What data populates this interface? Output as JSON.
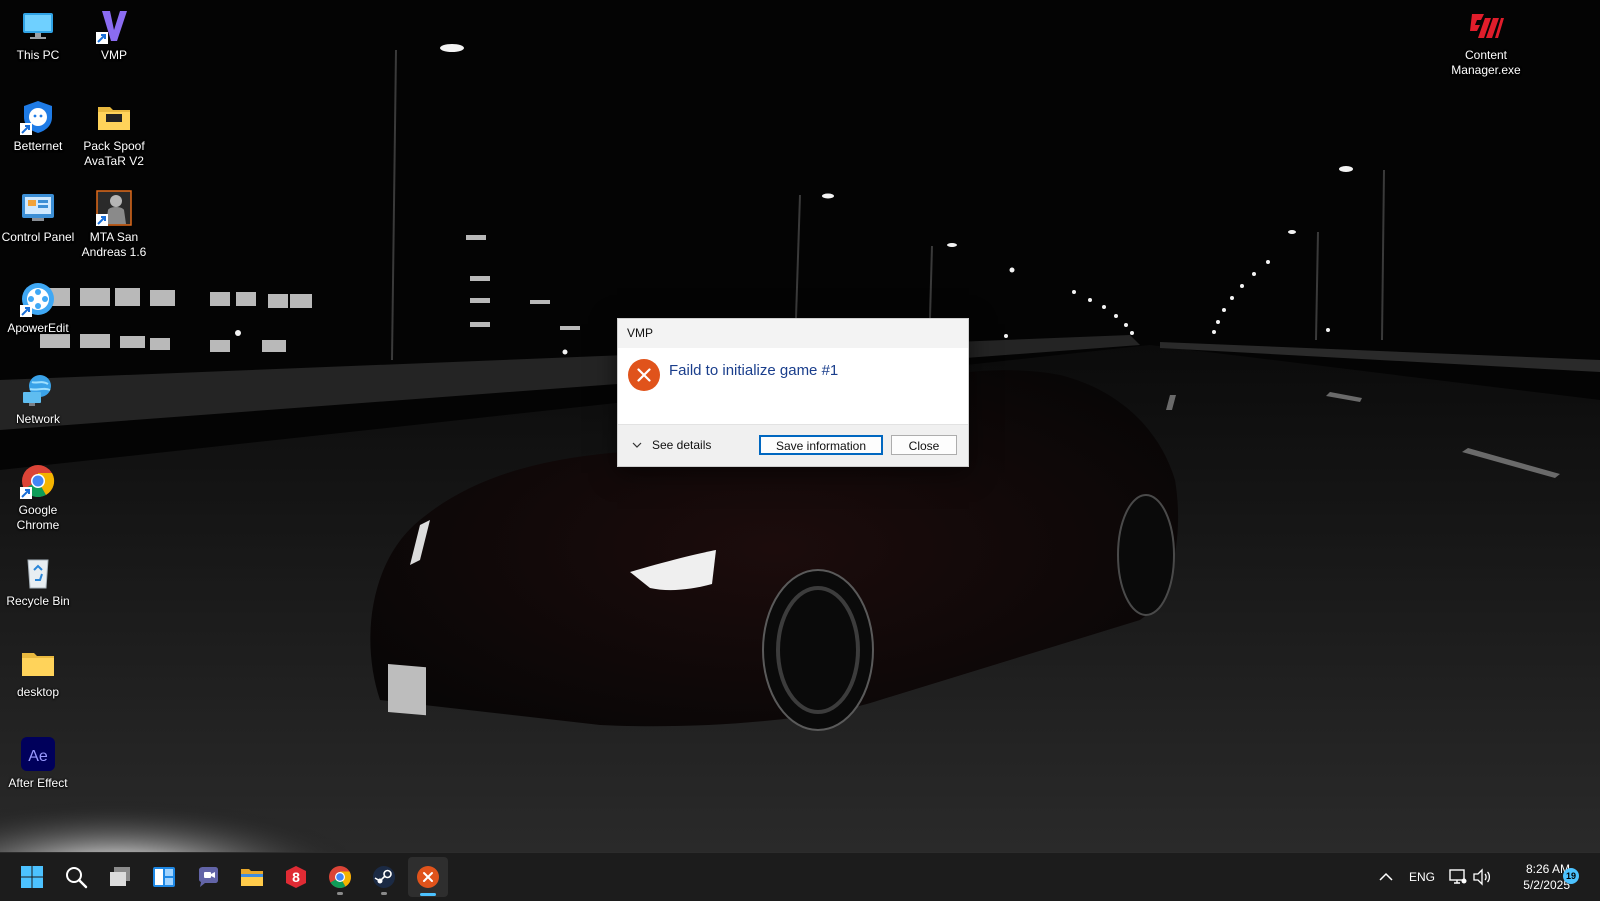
{
  "desktop": {
    "icons": [
      {
        "label": "This PC",
        "icon": "this-pc-icon"
      },
      {
        "label": "VMP",
        "icon": "vmp-icon"
      },
      {
        "label": "Betternet",
        "icon": "betternet-icon"
      },
      {
        "label": "Pack Spoof AvaTaR V2",
        "icon": "folder-icon"
      },
      {
        "label": "Control Panel",
        "icon": "control-panel-icon"
      },
      {
        "label": "MTA San Andreas 1.6",
        "icon": "mta-icon"
      },
      {
        "label": "ApowerEdit",
        "icon": "apoweredit-icon"
      },
      {
        "label": "Network",
        "icon": "network-icon"
      },
      {
        "label": "Google Chrome",
        "icon": "chrome-icon"
      },
      {
        "label": "Recycle Bin",
        "icon": "recycle-bin-icon"
      },
      {
        "label": "desktop",
        "icon": "folder-icon"
      },
      {
        "label": "After Effect",
        "icon": "after-effects-icon"
      },
      {
        "label": "Content Manager.exe",
        "icon": "content-manager-icon"
      }
    ]
  },
  "dialog": {
    "title": "VMP",
    "message": "Faild to initialize game #1",
    "see_details": "See details",
    "save_label": "Save information",
    "close_label": "Close",
    "error_color": "#e0531b"
  },
  "taskbar": {
    "apps": [
      {
        "name": "start",
        "icon": "windows-start-icon"
      },
      {
        "name": "search",
        "icon": "search-icon"
      },
      {
        "name": "task-view",
        "icon": "task-view-icon"
      },
      {
        "name": "widgets",
        "icon": "widgets-icon"
      },
      {
        "name": "chat",
        "icon": "chat-icon"
      },
      {
        "name": "file-explorer",
        "icon": "folder-icon"
      },
      {
        "name": "app-8",
        "icon": "app-8-icon"
      },
      {
        "name": "chrome",
        "icon": "chrome-icon"
      },
      {
        "name": "steam",
        "icon": "steam-icon"
      },
      {
        "name": "vmp-error",
        "icon": "error-icon"
      }
    ],
    "language": "ENG",
    "time": "8:26 AM",
    "date": "5/2/2025",
    "notification_count": "19",
    "accent": "#4cc2ff"
  }
}
